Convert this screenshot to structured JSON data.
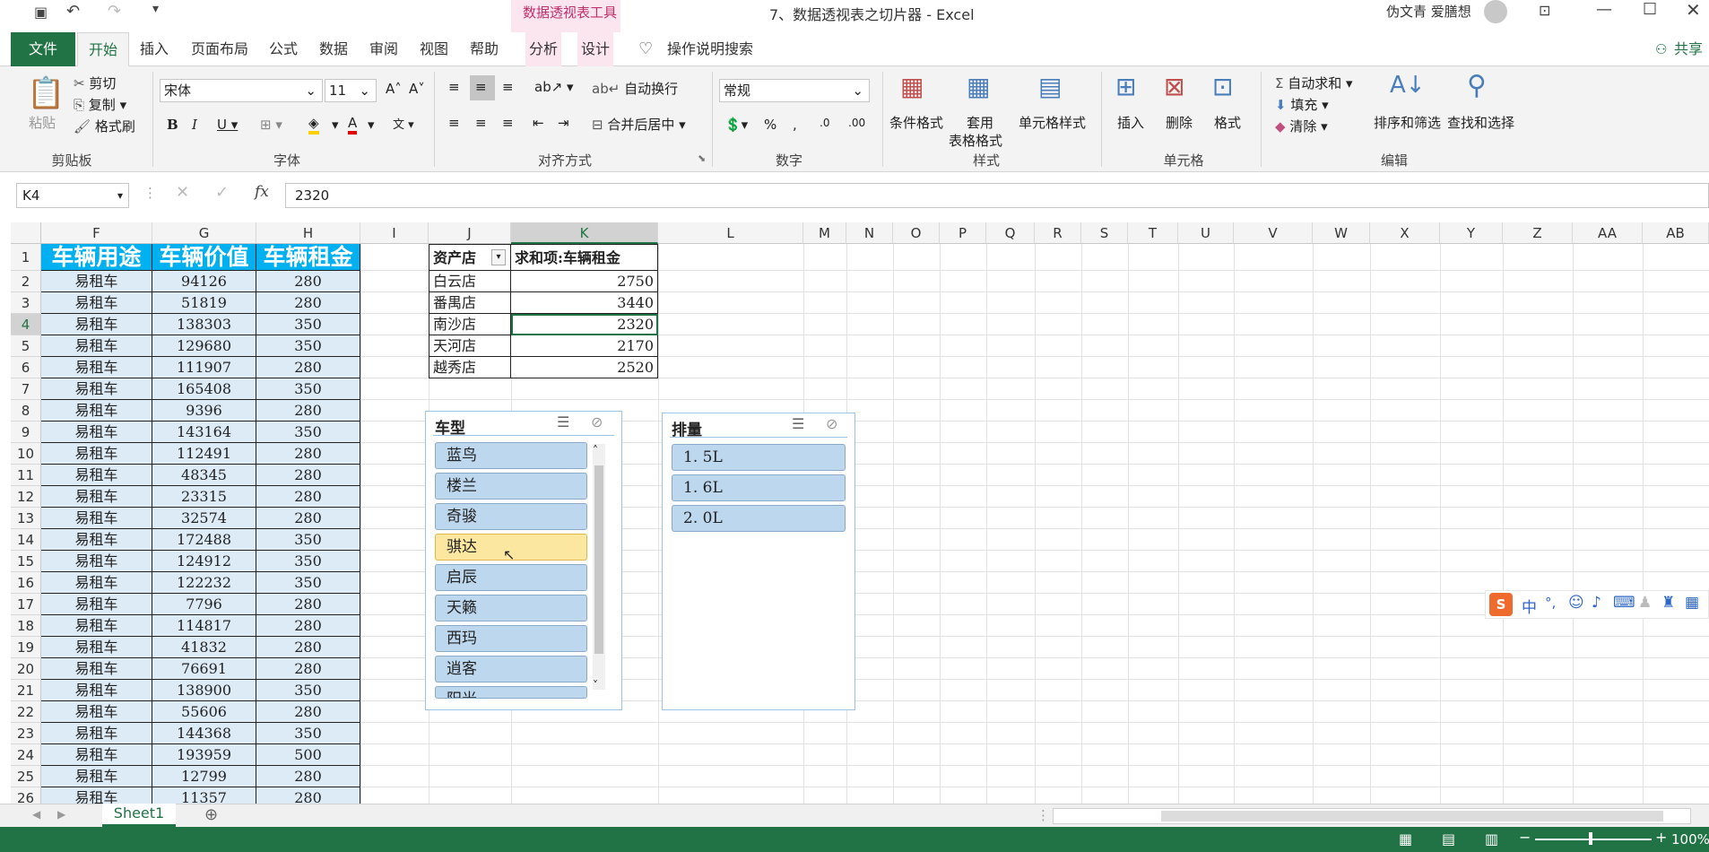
{
  "window": {
    "title": "7、数据透视表之切片器 - Excel",
    "context_group": "数据透视表工具",
    "user": "伪文青 爱膳想"
  },
  "tabs": [
    "文件",
    "开始",
    "插入",
    "页面布局",
    "公式",
    "数据",
    "审阅",
    "视图",
    "帮助",
    "分析",
    "设计"
  ],
  "tell_me": "操作说明搜索",
  "share": "共享",
  "ribbon": {
    "clipboard": {
      "paste": "粘贴",
      "cut": "剪切",
      "copy": "复制",
      "painter": "格式刷",
      "label": "剪贴板"
    },
    "font": {
      "name": "宋体",
      "size": "11",
      "label": "字体"
    },
    "align": {
      "wrap": "自动换行",
      "merge": "合并后居中",
      "label": "对齐方式"
    },
    "number": {
      "format": "常规",
      "label": "数字"
    },
    "styles": {
      "cond": "条件格式",
      "table1": "套用",
      "table2": "表格格式",
      "cell": "单元格样式",
      "label": "样式"
    },
    "cells": {
      "insert": "插入",
      "delete": "删除",
      "format": "格式",
      "label": "单元格"
    },
    "edit": {
      "autosum": "自动求和",
      "fill": "填充",
      "clear": "清除",
      "sort": "排序和筛选",
      "find": "查找和选择",
      "label": "编辑"
    }
  },
  "formula_bar": {
    "name_box": "K4",
    "value": "2320",
    "fx": "fx"
  },
  "columns": [
    "F",
    "G",
    "H",
    "I",
    "J",
    "K",
    "L",
    "M",
    "N",
    "O",
    "P",
    "Q",
    "R",
    "S",
    "T",
    "U",
    "V",
    "W",
    "X",
    "Y",
    "Z",
    "AA",
    "AB"
  ],
  "table": {
    "headers": [
      "车辆用途",
      "车辆价值",
      "车辆租金"
    ],
    "rows": [
      [
        "易租车",
        "94126",
        "280"
      ],
      [
        "易租车",
        "51819",
        "280"
      ],
      [
        "易租车",
        "138303",
        "350"
      ],
      [
        "易租车",
        "129680",
        "350"
      ],
      [
        "易租车",
        "111907",
        "280"
      ],
      [
        "易租车",
        "165408",
        "350"
      ],
      [
        "易租车",
        "9396",
        "280"
      ],
      [
        "易租车",
        "143164",
        "350"
      ],
      [
        "易租车",
        "112491",
        "280"
      ],
      [
        "易租车",
        "48345",
        "280"
      ],
      [
        "易租车",
        "23315",
        "280"
      ],
      [
        "易租车",
        "32574",
        "280"
      ],
      [
        "易租车",
        "172488",
        "350"
      ],
      [
        "易租车",
        "124912",
        "350"
      ],
      [
        "易租车",
        "122232",
        "350"
      ],
      [
        "易租车",
        "7796",
        "280"
      ],
      [
        "易租车",
        "114817",
        "280"
      ],
      [
        "易租车",
        "41832",
        "280"
      ],
      [
        "易租车",
        "76691",
        "280"
      ],
      [
        "易租车",
        "138900",
        "350"
      ],
      [
        "易租车",
        "55606",
        "280"
      ],
      [
        "易租车",
        "144368",
        "350"
      ],
      [
        "易租车",
        "193959",
        "500"
      ],
      [
        "易租车",
        "12799",
        "280"
      ],
      [
        "易租车",
        "11357",
        "280"
      ]
    ]
  },
  "pivot": {
    "header": [
      "资产店",
      "求和项:车辆租金"
    ],
    "rows": [
      [
        "白云店",
        "2750"
      ],
      [
        "番禺店",
        "3440"
      ],
      [
        "南沙店",
        "2320"
      ],
      [
        "天河店",
        "2170"
      ],
      [
        "越秀店",
        "2520"
      ]
    ]
  },
  "slicer_car": {
    "title": "车型",
    "items": [
      "蓝鸟",
      "楼兰",
      "奇骏",
      "骐达",
      "启辰",
      "天籁",
      "西玛",
      "逍客",
      "阳光"
    ],
    "selected": "骐达"
  },
  "slicer_disp": {
    "title": "排量",
    "items": [
      "1. 5L",
      "1. 6L",
      "2. 0L"
    ]
  },
  "sheet_tab": "Sheet1",
  "zoom": "100%",
  "ime": "中"
}
